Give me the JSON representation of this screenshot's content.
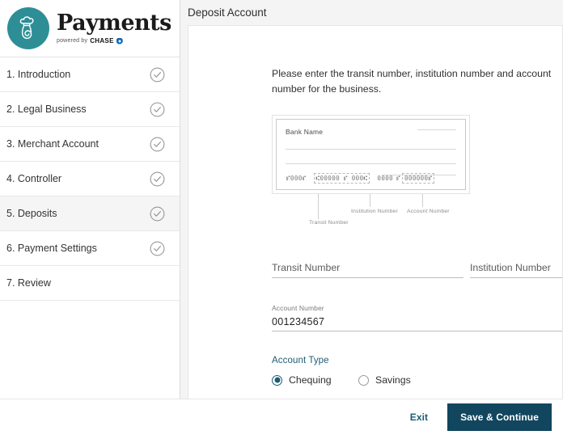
{
  "brand": {
    "logo_icon": "chef-hat-spiral-icon",
    "title": "Payments",
    "powered_by_prefix": "powered by",
    "powered_by_name": "CHASE",
    "chase_icon": "chase-octagon-icon",
    "accent_color": "#2e8e96"
  },
  "sidebar": {
    "items": [
      {
        "label": "1. Introduction",
        "complete": true,
        "active": false,
        "icon": "check-circle-icon"
      },
      {
        "label": "2. Legal Business",
        "complete": true,
        "active": false,
        "icon": "check-circle-icon"
      },
      {
        "label": "3. Merchant Account",
        "complete": true,
        "active": false,
        "icon": "check-circle-icon"
      },
      {
        "label": "4. Controller",
        "complete": true,
        "active": false,
        "icon": "check-circle-icon"
      },
      {
        "label": "5. Deposits",
        "complete": true,
        "active": true,
        "icon": "check-circle-icon"
      },
      {
        "label": "6. Payment Settings",
        "complete": true,
        "active": false,
        "icon": "check-circle-icon"
      },
      {
        "label": "7. Review",
        "complete": false,
        "active": false,
        "icon": ""
      }
    ]
  },
  "header": {
    "title": "Deposit Account"
  },
  "main": {
    "intro": "Please enter the transit number, institution number and account number for the business.",
    "cheque": {
      "bank_name": "Bank Name",
      "micr": {
        "cheque_number": "⑈000⑈",
        "transit": "⑆00000 ⑈ 000⑆",
        "institution": "0000",
        "separator": "⑈",
        "account": "000000⑈"
      },
      "callouts": [
        {
          "label": "Transit Number"
        },
        {
          "label": "Institution Number"
        },
        {
          "label": "Account Number"
        }
      ]
    },
    "fields": {
      "transit": {
        "label": "Transit Number",
        "value": "",
        "placeholder": "Transit Number"
      },
      "institution": {
        "label": "Institution Number",
        "value": "",
        "placeholder": "Institution Number"
      },
      "account": {
        "label": "Account Number",
        "value": "001234567",
        "placeholder": "Account Number"
      }
    },
    "account_type": {
      "label": "Account Type",
      "accent_color": "#1d5c73",
      "options": [
        {
          "label": "Chequing",
          "selected": true
        },
        {
          "label": "Savings",
          "selected": false
        }
      ]
    }
  },
  "footer": {
    "exit_label": "Exit",
    "save_label": "Save & Continue",
    "primary_color": "#11465e"
  }
}
